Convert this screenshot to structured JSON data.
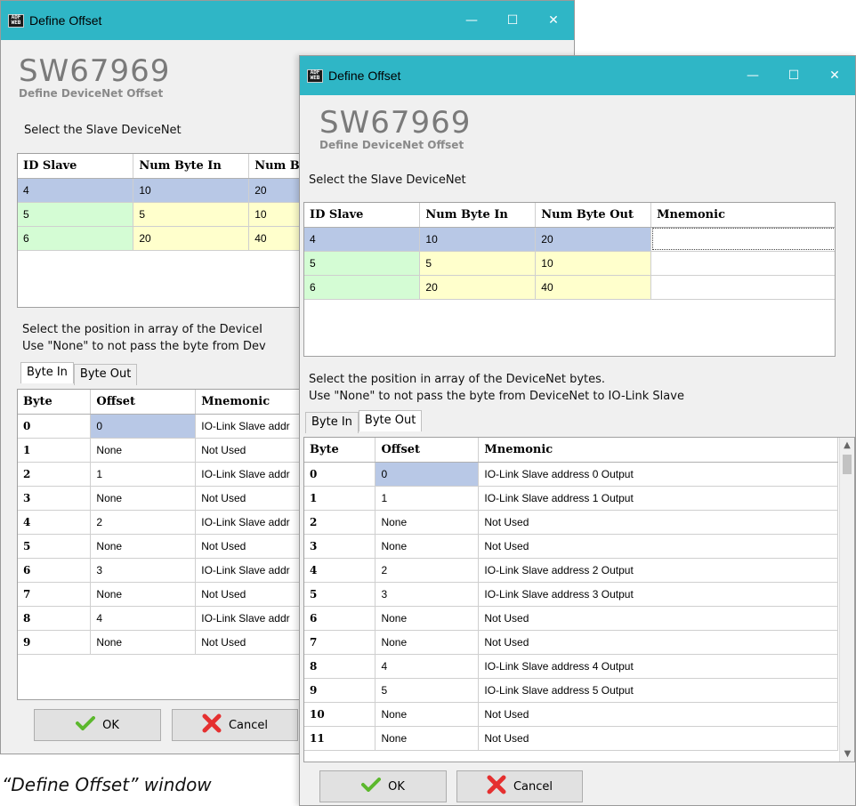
{
  "window_back": {
    "title": "Define Offset",
    "brand_code": "SW67969",
    "brand_sub": "Define DeviceNet Offset",
    "select_label": "Select the Slave DeviceNet",
    "slave_headers": [
      "ID Slave",
      "Num Byte In",
      "Num By"
    ],
    "slave_rows": [
      [
        "4",
        "10",
        "20"
      ],
      [
        "5",
        "5",
        "10"
      ],
      [
        "6",
        "20",
        "40"
      ]
    ],
    "instr1": "Select the position in array of the DeviceI",
    "instr2": "Use \"None\" to not pass the byte from Dev",
    "tab_in": "Byte In",
    "tab_out": "Byte Out",
    "byte_headers": [
      "Byte",
      "Offset",
      "Mnemonic"
    ],
    "byte_rows": [
      [
        "0",
        "0",
        "IO-Link Slave addr"
      ],
      [
        "1",
        "None",
        "Not Used"
      ],
      [
        "2",
        "1",
        "IO-Link Slave addr"
      ],
      [
        "3",
        "None",
        "Not Used"
      ],
      [
        "4",
        "2",
        "IO-Link Slave addr"
      ],
      [
        "5",
        "None",
        "Not Used"
      ],
      [
        "6",
        "3",
        "IO-Link Slave addr"
      ],
      [
        "7",
        "None",
        "Not Used"
      ],
      [
        "8",
        "4",
        "IO-Link Slave addr"
      ],
      [
        "9",
        "None",
        "Not Used"
      ]
    ],
    "ok_label": "OK",
    "cancel_label": "Cancel"
  },
  "window_front": {
    "title": "Define Offset",
    "brand_code": "SW67969",
    "brand_sub": "Define DeviceNet Offset",
    "select_label": "Select the Slave DeviceNet",
    "slave_headers": [
      "ID Slave",
      "Num Byte In",
      "Num Byte Out",
      "Mnemonic"
    ],
    "slave_rows": [
      [
        "4",
        "10",
        "20",
        ""
      ],
      [
        "5",
        "5",
        "10",
        ""
      ],
      [
        "6",
        "20",
        "40",
        ""
      ]
    ],
    "instr1": "Select the position in array of the DeviceNet bytes.",
    "instr2": "Use \"None\" to not pass the byte from DeviceNet to IO-Link Slave",
    "tab_in": "Byte In",
    "tab_out": "Byte Out",
    "byte_headers": [
      "Byte",
      "Offset",
      "Mnemonic"
    ],
    "byte_rows": [
      [
        "0",
        "0",
        "IO-Link Slave address 0 Output"
      ],
      [
        "1",
        "1",
        "IO-Link Slave address 1 Output"
      ],
      [
        "2",
        "None",
        "Not Used"
      ],
      [
        "3",
        "None",
        "Not Used"
      ],
      [
        "4",
        "2",
        "IO-Link Slave address 2 Output"
      ],
      [
        "5",
        "3",
        "IO-Link Slave address 3 Output"
      ],
      [
        "6",
        "None",
        "Not Used"
      ],
      [
        "7",
        "None",
        "Not Used"
      ],
      [
        "8",
        "4",
        "IO-Link Slave address 4 Output"
      ],
      [
        "9",
        "5",
        "IO-Link Slave address 5 Output"
      ],
      [
        "10",
        "None",
        "Not Used"
      ],
      [
        "11",
        "None",
        "Not Used"
      ]
    ],
    "ok_label": "OK",
    "cancel_label": "Cancel"
  },
  "window_controls": {
    "minimize": "—",
    "maximize": "☐",
    "close": "✕"
  },
  "caption": "“Define Offset” window",
  "colors": {
    "titlebar": "#2fb6c6",
    "selected": "#b8c8e6",
    "green": "#d4fcd4",
    "yellow": "#ffffcc"
  },
  "icons": [
    "adfweb-logo-icon",
    "check-icon",
    "cancel-x-icon"
  ]
}
